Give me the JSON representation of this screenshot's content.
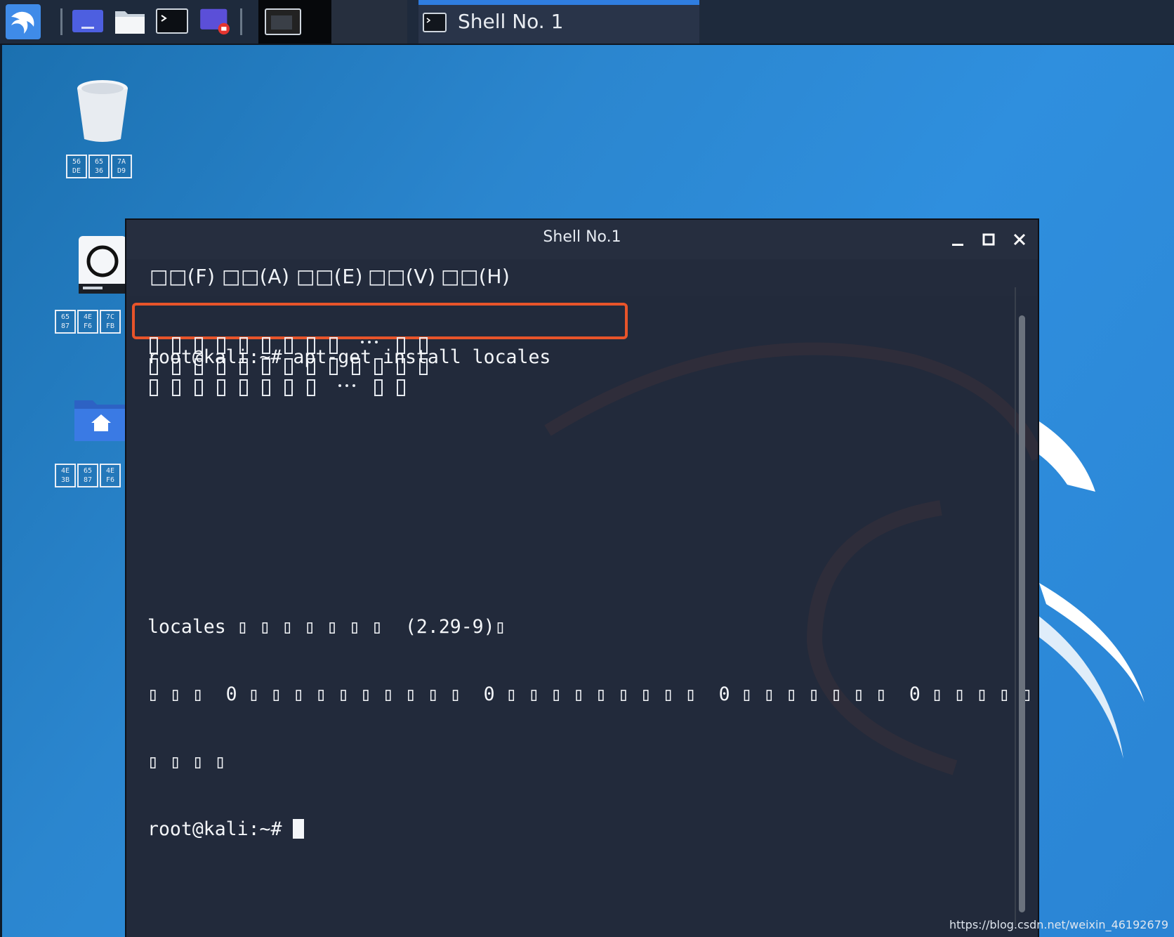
{
  "taskbar": {
    "active_task_label": "Shell No. 1",
    "icons": [
      "kali-menu-icon",
      "show-desktop-icon",
      "file-manager-icon",
      "terminal-icon",
      "screen-recorder-icon",
      "workspace-terminal-icon"
    ]
  },
  "desktop": {
    "icons": [
      {
        "name": "trash-icon",
        "label_boxes": [
          [
            "56",
            "DE"
          ],
          [
            "65",
            "36"
          ],
          [
            "7A",
            "D9"
          ]
        ]
      },
      {
        "name": "filesystem-icon",
        "label_boxes": [
          [
            "65",
            "87"
          ],
          [
            "4E",
            "F6"
          ],
          [
            "7C",
            "FB"
          ]
        ]
      },
      {
        "name": "home-folder-icon",
        "label_boxes": [
          [
            "4E",
            "3B"
          ],
          [
            "65",
            "87"
          ],
          [
            "4E",
            "F6"
          ]
        ]
      }
    ]
  },
  "shell": {
    "title": "Shell No.1",
    "menu": [
      "□□(F)",
      "□□(A)",
      "□□(E)",
      "□□(V)",
      "□□(H)"
    ],
    "lines": {
      "command": "root@kali:~# apt-get install locales",
      "locales_line": "locales ▯ ▯ ▯ ▯ ▯ ▯ ▯  (2.29-9)▯",
      "summary_line": "▯ ▯ ▯  0 ▯ ▯ ▯ ▯ ▯ ▯ ▯ ▯ ▯ ▯  0 ▯ ▯ ▯ ▯ ▯ ▯ ▯ ▯ ▯  0 ▯ ▯ ▯ ▯ ▯ ▯ ▯  0 ▯ ▯ ▯ ▯ ▯",
      "summary_line_2": "▯ ▯ ▯ ▯",
      "prompt": "root@kali:~# "
    }
  },
  "watermark": "https://blog.csdn.net/weixin_46192679",
  "colors": {
    "highlight_border": "#e8542a",
    "terminal_bg": "#222a3b",
    "taskbar_bg": "#1e2a3c",
    "task_active_bar": "#2f7de0"
  }
}
